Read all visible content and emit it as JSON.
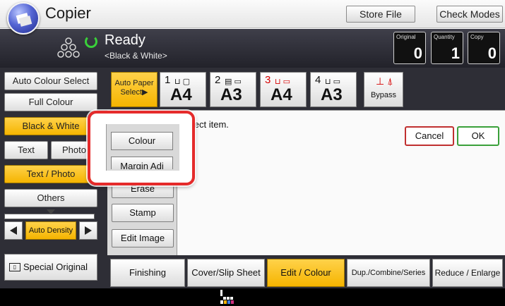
{
  "header": {
    "title": "Copier",
    "store_file": "Store File",
    "check_modes": "Check Modes"
  },
  "status": {
    "state": "Ready",
    "detail": "<Black & White>",
    "counters": [
      {
        "label": "Original",
        "value": "0"
      },
      {
        "label": "Quantity",
        "value": "1"
      },
      {
        "label": "Copy",
        "value": "0"
      }
    ]
  },
  "color_modes": {
    "auto_colour_select": "Auto Colour Select",
    "full_colour": "Full Colour",
    "black_white": "Black & White"
  },
  "original_types": {
    "text": "Text",
    "photo": "Photo",
    "text_photo": "Text / Photo",
    "others": "Others"
  },
  "density": {
    "label": "Auto Density",
    "level": 0.5
  },
  "special_original": "Special Original",
  "paper": {
    "auto_paper_line1": "Auto Paper",
    "auto_paper_line2": "Select▶",
    "trays": [
      {
        "num": "1",
        "size": "A4"
      },
      {
        "num": "2",
        "size": "A3"
      },
      {
        "num": "3",
        "size": "A4"
      },
      {
        "num": "4",
        "size": "A3"
      }
    ],
    "bypass": "Bypass"
  },
  "edit_menu": {
    "colour": "Colour",
    "margin_adj": "Margin Adj",
    "erase": "Erase",
    "stamp": "Stamp",
    "edit_image": "Edit Image"
  },
  "main": {
    "message": "Select item.",
    "cancel": "Cancel",
    "ok": "OK"
  },
  "tabs": [
    "Finishing",
    "Cover/Slip Sheet",
    "Edit / Colour",
    "Dup./Combine/Series",
    "Reduce / Enlarge"
  ],
  "colors": {
    "accent": "#f5b400",
    "highlight": "#e52b2b",
    "panel_dark": "#2e2e36",
    "ok_border": "#3aa03a",
    "cancel_border": "#c03030"
  }
}
